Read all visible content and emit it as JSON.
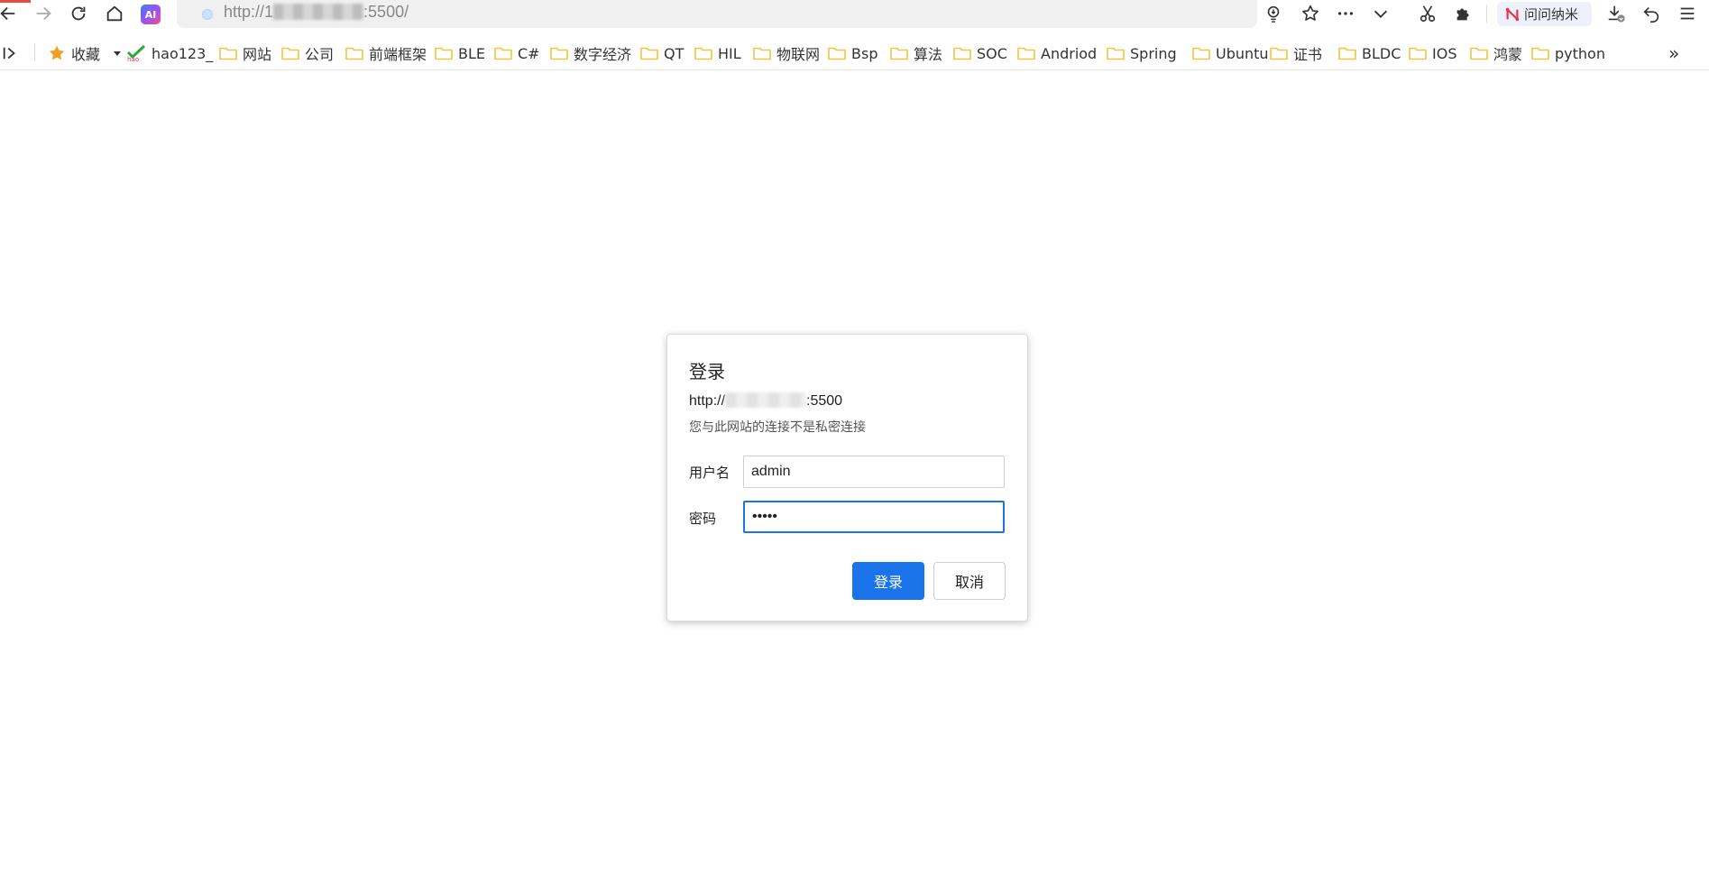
{
  "browser": {
    "address": {
      "prefix": "http://1",
      "suffix": ":5500/"
    },
    "wenwen_label": "问问纳米"
  },
  "bookmarks": {
    "favorites_label": "收藏",
    "hao_label": "hao123_",
    "folders": [
      "网站",
      "公司",
      "前端框架",
      "BLE",
      "C#",
      "数字经济",
      "QT",
      "HIL",
      "物联网",
      "Bsp",
      "算法",
      "SOC",
      "Andriod",
      "Spring",
      "Ubuntu",
      "证书",
      "BLDC",
      "IOS",
      "鸿蒙",
      "python"
    ],
    "more_label": "»"
  },
  "dialog": {
    "title": "登录",
    "origin_prefix": "http://",
    "origin_suffix": ":5500",
    "warning": "您与此网站的连接不是私密连接",
    "username_label": "用户名",
    "username_value": "admin",
    "password_label": "密码",
    "password_value": "•••••",
    "login_button": "登录",
    "cancel_button": "取消"
  },
  "colors": {
    "accent": "#1a73e8",
    "folder": "#f5c242",
    "star": "#f0a020"
  }
}
